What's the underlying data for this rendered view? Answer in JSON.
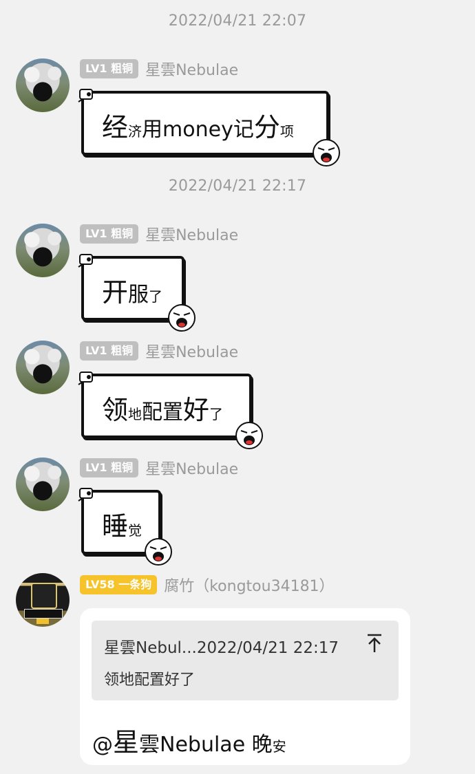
{
  "timestamps": [
    "2022/04/21 22:07",
    "2022/04/21 22:17"
  ],
  "user_nebulae": {
    "level_badge": "LV1 粗铜",
    "name": "星雲Nebulae",
    "avatar_icon": "cow-avatar"
  },
  "messages": [
    {
      "parts": [
        [
          "经",
          "big"
        ],
        [
          "济",
          "sm"
        ],
        [
          "用",
          "mid"
        ],
        [
          "money",
          "mid"
        ],
        [
          "记",
          "mid"
        ],
        [
          "分",
          "big"
        ],
        [
          "项",
          "sm"
        ]
      ]
    },
    {
      "parts": [
        [
          "开",
          "big"
        ],
        [
          "服",
          "mid"
        ],
        [
          "了",
          "sm"
        ]
      ]
    },
    {
      "parts": [
        [
          "领",
          "big"
        ],
        [
          "地",
          "sm"
        ],
        [
          "配置",
          "mid"
        ],
        [
          "好",
          "big"
        ],
        [
          "了",
          "sm"
        ]
      ]
    },
    {
      "parts": [
        [
          "睡",
          "big"
        ],
        [
          "觉",
          "sm"
        ]
      ]
    }
  ],
  "reply": {
    "level_badge": "LV58 一条狗",
    "name": "腐竹（kongtou34181）",
    "badge_color": "#f7c32a",
    "quote_header": "星雲Nebul...2022/04/21 22:17",
    "quote_text": "领地配置好了",
    "mention_at": "@",
    "mention_big": "星",
    "mention_rest": "雲Nebulae 晚",
    "mention_small": "安"
  }
}
